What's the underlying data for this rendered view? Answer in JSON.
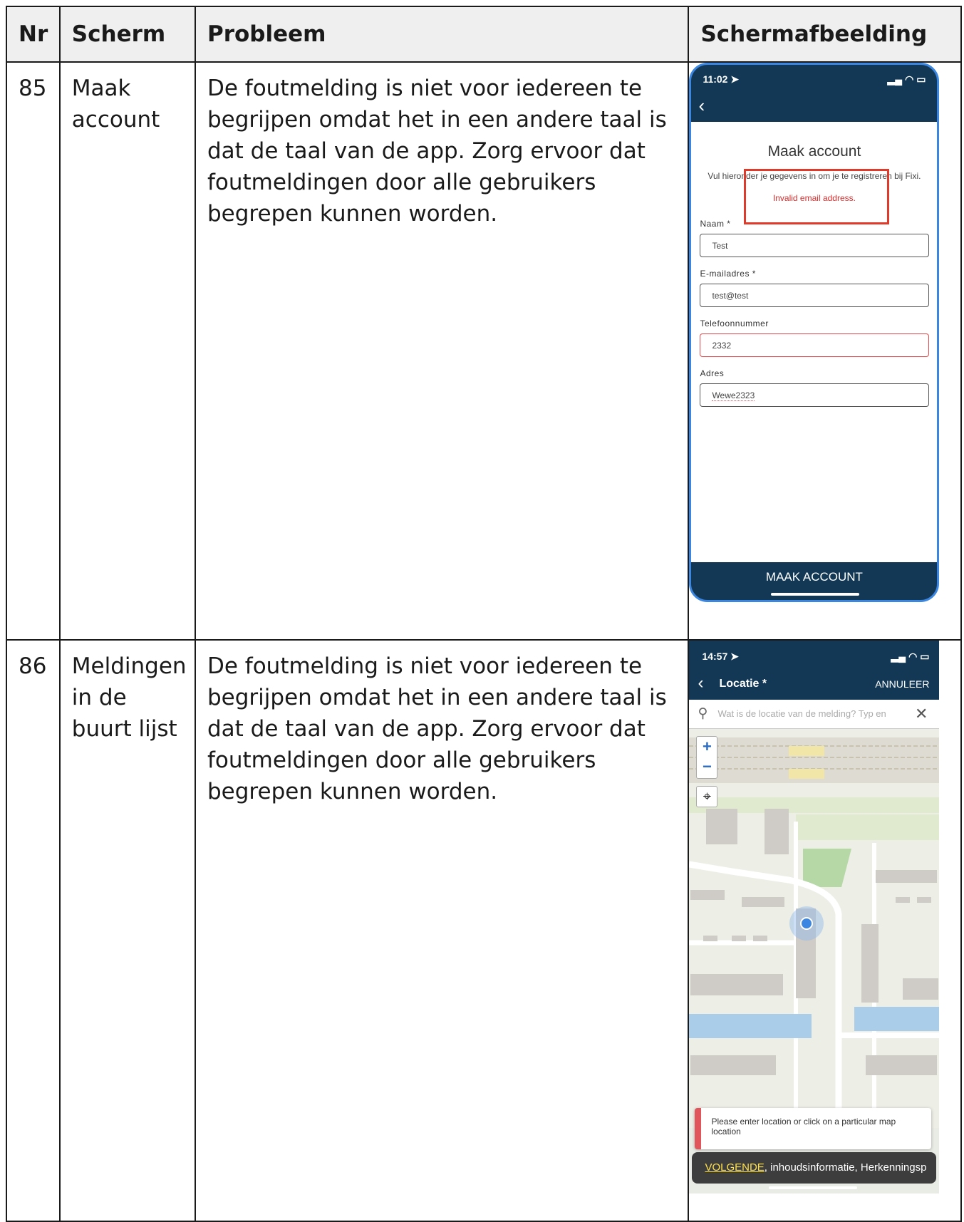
{
  "headers": {
    "nr": "Nr",
    "scherm": "Scherm",
    "probleem": "Probleem",
    "afbeelding": "Schermafbeelding"
  },
  "rows": [
    {
      "nr": "85",
      "scherm": "Maak account",
      "probleem": "De foutmelding is niet voor iedereen te begrijpen omdat het in een andere taal is dat de taal van de app. Zorg ervoor dat foutmeldingen door alle gebruikers begrepen kunnen worden.",
      "phone": {
        "time": "11:02 ➤",
        "title": "Maak account",
        "subtitle": "Vul hieronder je gegevens in om je te registreren bij Fixi.",
        "error": "Invalid email address.",
        "fields": [
          {
            "label": "Naam *",
            "value": "Test"
          },
          {
            "label": "E-mailadres *",
            "value": "test@test"
          },
          {
            "label": "Telefoonnummer",
            "value": "2332"
          },
          {
            "label": "Adres",
            "value": "Wewe2323"
          }
        ],
        "button": "MAAK ACCOUNT"
      }
    },
    {
      "nr": "86",
      "scherm": "Meldingen in de buurt lijst",
      "probleem": "De foutmelding is niet voor iedereen te begrijpen omdat het in een andere taal is dat de taal van de app. Zorg ervoor dat foutmeldingen door alle gebruikers begrepen kunnen worden.",
      "phone": {
        "time": "14:57 ➤",
        "title": "Locatie *",
        "cancel": "ANNULEER",
        "search_placeholder": "Wat is de locatie van de melding? Typ en",
        "toast": "Please enter location or click on a particular map location",
        "voiceover_highlight": "VOLGENDE",
        "voiceover_rest": ", inhoudsinformatie, Herkenningsp"
      }
    }
  ]
}
